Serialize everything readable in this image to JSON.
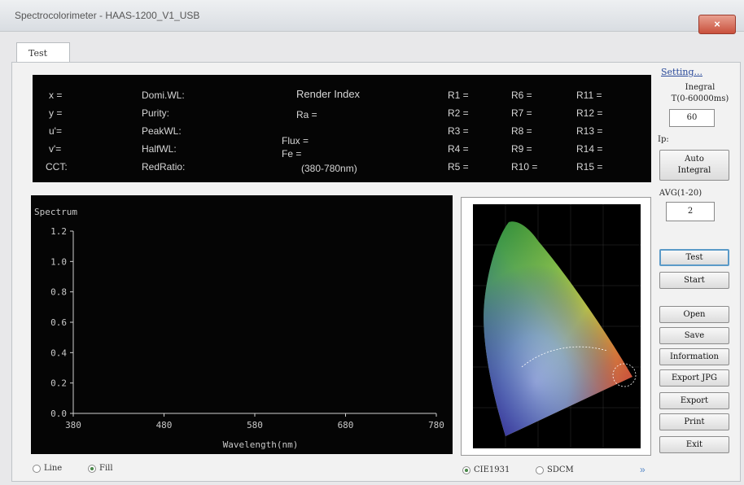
{
  "window": {
    "title": "Spectrocolorimeter - HAAS-1200_V1_USB",
    "close_label": "×"
  },
  "tabs": [
    {
      "label": "Test"
    }
  ],
  "info_panel": {
    "col1": [
      "x =",
      "y =",
      "u'=",
      "v'=",
      "CCT:"
    ],
    "col2": [
      "Domi.WL:",
      "Purity:",
      "PeakWL:",
      "HalfWL:",
      "RedRatio:"
    ],
    "render_index": "Render Index",
    "ra": "Ra =",
    "flux": "Flux =",
    "fe": "Fe =",
    "range": "(380-780nm)",
    "r_col1": [
      "R1 =",
      "R2 =",
      "R3 =",
      "R4 =",
      "R5 ="
    ],
    "r_col2": [
      "R6 =",
      "R7 =",
      "R8 =",
      "R9 =",
      "R10 ="
    ],
    "r_col3": [
      "R11 =",
      "R12 =",
      "R13 =",
      "R14 =",
      "R15 ="
    ]
  },
  "chart_data": {
    "type": "area",
    "title": "Spectrum",
    "xlabel": "Wavelength(nm)",
    "ylabel": "",
    "xlim": [
      380,
      780
    ],
    "ylim": [
      0.0,
      1.2
    ],
    "x_ticks": [
      "380",
      "480",
      "580",
      "680",
      "780"
    ],
    "y_ticks": [
      "0.0",
      "0.2",
      "0.4",
      "0.6",
      "0.8",
      "1.0",
      "1.2"
    ],
    "series": []
  },
  "sidebar": {
    "setting_link": "Setting...",
    "integral_label_1": "Inegral",
    "integral_label_2": "T(0-60000ms)",
    "integral_value": "60",
    "ip_label": "Ip:",
    "auto_integral_1": "Auto",
    "auto_integral_2": "Integral",
    "avg_label": "AVG(1-20)",
    "avg_value": "2",
    "buttons": {
      "test": "Test",
      "start": "Start",
      "open": "Open",
      "save": "Save",
      "information": "Information",
      "export_jpg": "Export JPG",
      "export": "Export",
      "print": "Print",
      "exit": "Exit"
    }
  },
  "bottom": {
    "line_label": "Line",
    "fill_label": "Fill",
    "cie1931_label": "CIE1931",
    "sdcm_label": "SDCM",
    "more_label": "»"
  },
  "selected": {
    "fill": true,
    "line": false,
    "cie1931": true,
    "sdcm": false
  },
  "colors": {
    "panel_bg": "#050505",
    "text": "#d6d6d6",
    "link": "#2a4a9a"
  }
}
